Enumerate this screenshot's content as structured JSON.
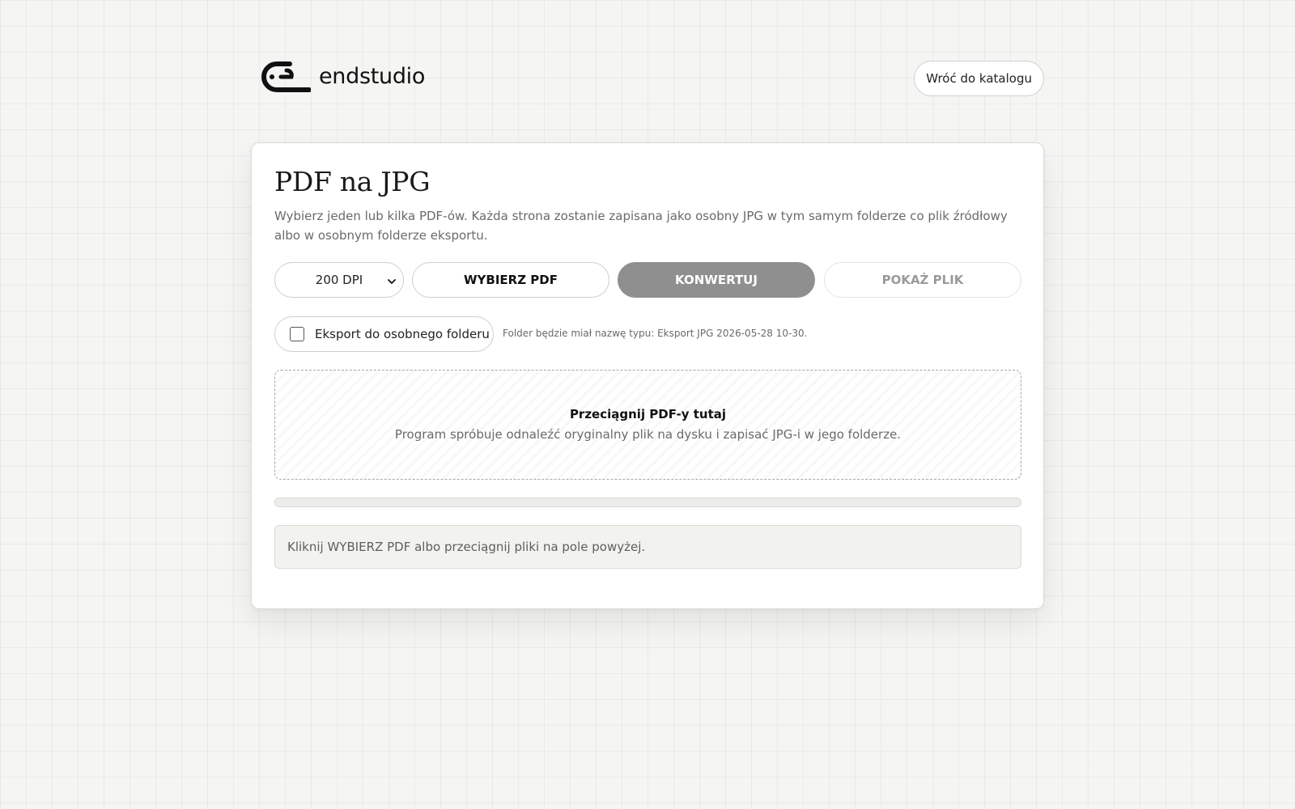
{
  "brand": {
    "name": "endstudio",
    "icon": "endstudio-logo-icon"
  },
  "header": {
    "back_label": "Wróć do katalogu"
  },
  "converter": {
    "title": "PDF na JPG",
    "description": "Wybierz jeden lub kilka PDF-ów. Każda strona zostanie zapisana jako osobny JPG w tym samym folderze co plik źródłowy albo w osobnym folderze eksportu.",
    "dpi": {
      "selected": "200 DPI",
      "icon": "chevron-down-icon"
    },
    "buttons": {
      "choose": "WYBIERZ PDF",
      "convert": "KONWERTUJ",
      "show": "POKAŻ PLIK"
    },
    "export": {
      "checkbox_label": "Eksport do osobnego folderu",
      "checked": false,
      "hint": "Folder będzie miał nazwę typu: Eksport JPG 2026-05-28 10-30."
    },
    "dropzone": {
      "title": "Przeciągnij PDF-y tutaj",
      "subtitle": "Program spróbuje odnaleźć oryginalny plik na dysku i zapisać JPG-i w jego folderze."
    },
    "progress": {
      "value": 0
    },
    "status": "Kliknij WYBIERZ PDF albo przeciągnij pliki na pole powyżej."
  },
  "colors": {
    "background": "#f5f5f3",
    "card": "#ffffff",
    "primary_disabled": "#8f8f8f",
    "text": "#1a1a1a",
    "muted_text": "#6a6a6a"
  }
}
